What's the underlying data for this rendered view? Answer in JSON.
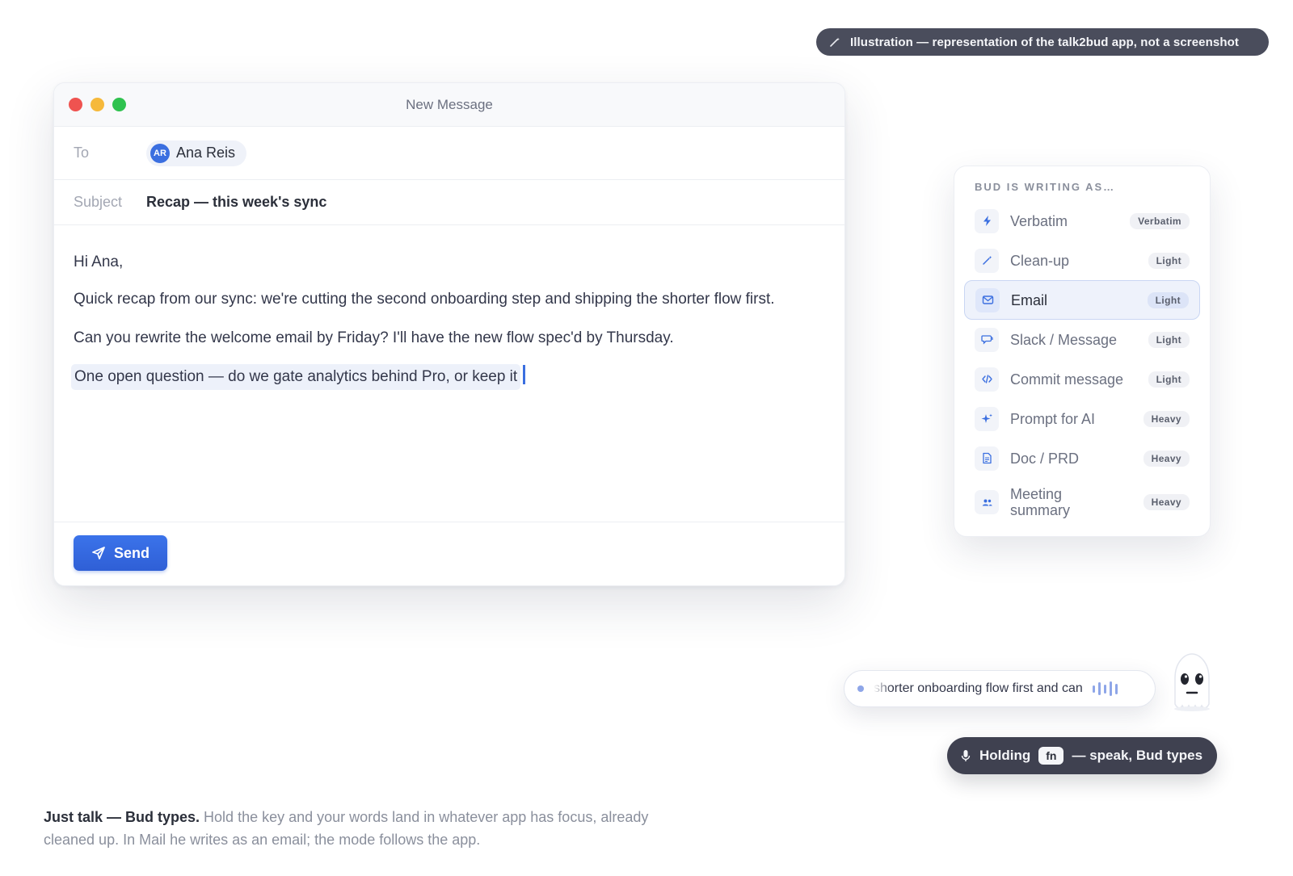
{
  "badge": {
    "text": "Illustration — representation of the talk2bud app, not a screenshot",
    "icon": "wand-icon"
  },
  "mail": {
    "window_title": "New Message",
    "to_label": "To",
    "recipient": {
      "initials": "AR",
      "name": "Ana Reis"
    },
    "subject_label": "Subject",
    "subject_value": "Recap — this week's sync",
    "body": {
      "greeting": "Hi Ana,",
      "paragraph_1": "Quick recap from our sync: we're cutting the second onboarding step and shipping the shorter flow first.",
      "paragraph_2": "Can you rewrite the welcome email by Friday? I'll have the new flow spec'd by Thursday.",
      "live_line": "One open question — do we gate analytics behind Pro, or keep it"
    },
    "send_label": "Send"
  },
  "mode_panel": {
    "heading": "BUD IS WRITING AS…",
    "items": [
      {
        "label": "Verbatim",
        "badge": "Verbatim",
        "icon": "bolt-icon"
      },
      {
        "label": "Clean-up",
        "badge": "Light",
        "icon": "wand-icon"
      },
      {
        "label": "Email",
        "badge": "Light",
        "icon": "envelope-icon",
        "active": true
      },
      {
        "label": "Slack / Message",
        "badge": "Light",
        "icon": "chat-bubble-icon"
      },
      {
        "label": "Commit message",
        "badge": "Light",
        "icon": "code-icon"
      },
      {
        "label": "Prompt for AI",
        "badge": "Heavy",
        "icon": "sparkle-icon"
      },
      {
        "label": "Doc / PRD",
        "badge": "Heavy",
        "icon": "document-icon"
      },
      {
        "label": "Meeting summary",
        "badge": "Heavy",
        "icon": "people-icon"
      }
    ]
  },
  "transcript": {
    "text": "shorter onboarding flow first and can"
  },
  "holding": {
    "prefix": "Holding",
    "key": "fn",
    "suffix": "— speak, Bud types"
  },
  "caption": {
    "lead": "Just talk — Bud types.",
    "text": " Hold the key and your words land in whatever app has focus, already cleaned up. In Mail he writes as an email; the mode follows the app."
  },
  "colors": {
    "accent": "#3b6fe0",
    "dark_pill": "#3f4150",
    "active_mode_bg": "#eef2fb"
  }
}
